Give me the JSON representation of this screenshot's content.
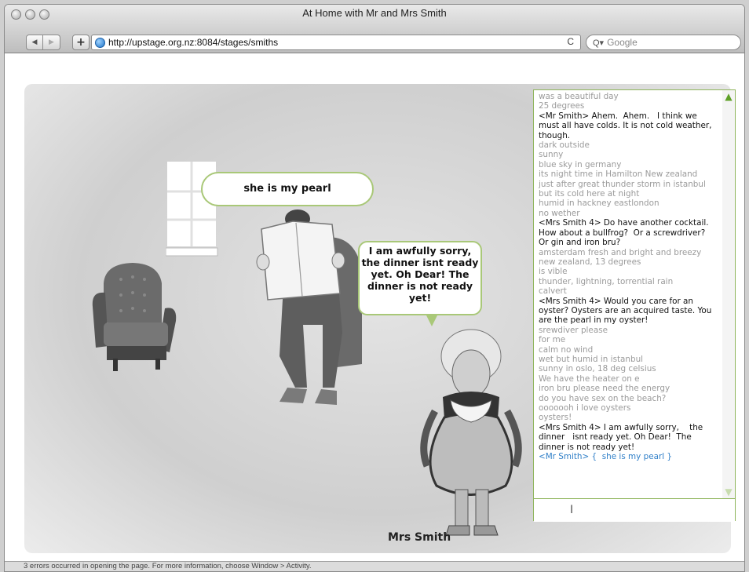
{
  "window": {
    "title": "At Home with Mr and Mrs Smith"
  },
  "toolbar": {
    "back_label": "◀",
    "forward_label": "▶",
    "add_label": "+",
    "url": "http://upstage.org.nz:8084/stages/smiths",
    "reload_label": "C",
    "search_placeholder": "Google",
    "search_icon": "Q▾"
  },
  "stage": {
    "mr_bubble": "she is my pearl",
    "mrs_bubble": "I am awfully sorry, the dinner isnt ready yet. Oh Dear! The dinner is not ready yet!",
    "mrs_label": "Mrs Smith"
  },
  "chat": {
    "lines": [
      {
        "text": "was a beautiful day",
        "type": "sys"
      },
      {
        "text": "25 degrees",
        "type": "sys"
      },
      {
        "text": "<Mr Smith> Ahem.  Ahem.   I think we must all have colds. It is not cold weather, though.",
        "type": "user"
      },
      {
        "text": "dark outside",
        "type": "sys"
      },
      {
        "text": "sunny",
        "type": "sys"
      },
      {
        "text": "blue sky in germany",
        "type": "sys"
      },
      {
        "text": "its night time in Hamilton New zealand",
        "type": "sys"
      },
      {
        "text": "just after great thunder storm in istanbul",
        "type": "sys"
      },
      {
        "text": "but its cold here at night",
        "type": "sys"
      },
      {
        "text": "humid in hackney eastlondon",
        "type": "sys"
      },
      {
        "text": "no wether",
        "type": "sys"
      },
      {
        "text": "<Mrs Smith 4> Do have another cocktail.   How about a bullfrog?  Or a screwdriver?  Or gin and iron bru?",
        "type": "user"
      },
      {
        "text": "amsterdam fresh and bright and breezy",
        "type": "sys"
      },
      {
        "text": "new zealand, 13 degrees",
        "type": "sys"
      },
      {
        "text": "is vible",
        "type": "sys"
      },
      {
        "text": "thunder, lightning, torrential rain",
        "type": "sys"
      },
      {
        "text": "calvert",
        "type": "sys"
      },
      {
        "text": "<Mrs Smith 4> Would you care for an oyster? Oysters are an acquired taste. You are the pearl in my oyster!",
        "type": "user"
      },
      {
        "text": "srewdiver please",
        "type": "sys"
      },
      {
        "text": "for me",
        "type": "sys"
      },
      {
        "text": "calm no wind",
        "type": "sys"
      },
      {
        "text": "wet but humid in istanbul",
        "type": "sys"
      },
      {
        "text": "sunny in oslo, 18 deg celsius",
        "type": "sys"
      },
      {
        "text": "We have the heater on e",
        "type": "sys"
      },
      {
        "text": "iron bru please need the energy",
        "type": "sys"
      },
      {
        "text": "do you have sex on the beach?",
        "type": "sys"
      },
      {
        "text": "ooooooh i love oysters",
        "type": "sys"
      },
      {
        "text": "oysters!",
        "type": "sys"
      },
      {
        "text": "<Mrs Smith 4> I am awfully sorry,    the dinner   isnt ready yet. Oh Dear!  The dinner is not ready yet!",
        "type": "user"
      },
      {
        "text": "<Mr Smith> {  she is my pearl }",
        "type": "self"
      }
    ],
    "input_value": "",
    "scroll_up": "▲",
    "scroll_down": "▼"
  },
  "status": {
    "text": "3 errors occurred in opening the page. For more information, choose Window > Activity."
  },
  "colors": {
    "accent": "#a9c878",
    "self": "#2f7fc8",
    "sys": "#9a9a9a"
  }
}
